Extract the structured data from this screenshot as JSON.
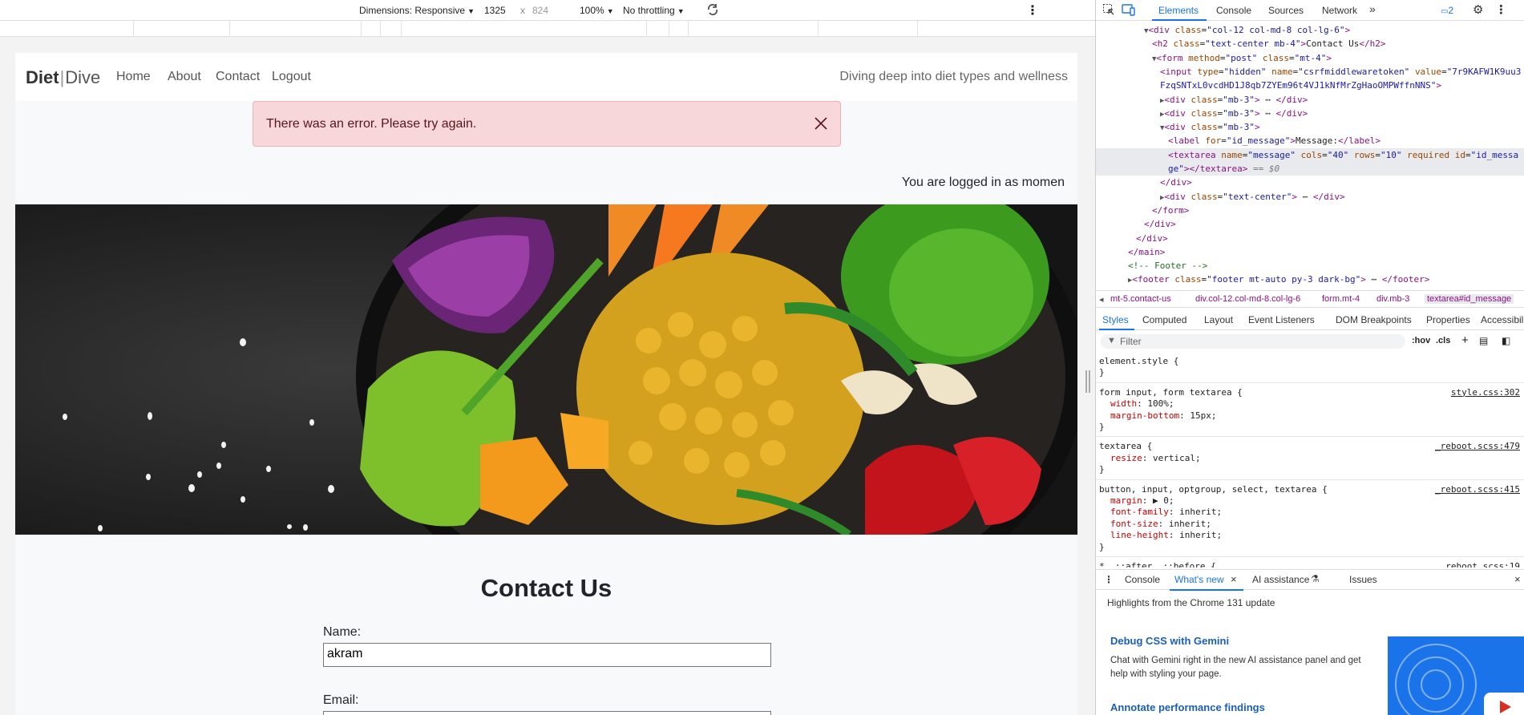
{
  "device_toolbar": {
    "dimensions_label": "Dimensions: Responsive",
    "width": "1325",
    "x_sep": "x",
    "height": "824",
    "zoom": "100%",
    "throttling": "No throttling"
  },
  "site": {
    "brand_bold": "Diet",
    "brand_sep": "|",
    "brand_light": "Dive",
    "nav": [
      "Home",
      "About",
      "Contact",
      "Logout"
    ],
    "tagline": "Diving deep into diet types and wellness",
    "alert": "There was an error. Please try again.",
    "logged_in": "You are logged in as momen",
    "contact_title": "Contact Us",
    "name_label": "Name:",
    "name_value": "akram",
    "email_label": "Email:"
  },
  "devtools": {
    "tabs": [
      "Elements",
      "Console",
      "Sources",
      "Network"
    ],
    "issues_count": "2",
    "dom": [
      {
        "indent": 0,
        "html": "<span class='tri'>▼</span><span class='tag'>&lt;div</span> <span class='attr'>class</span>=<span class='val'>\"col-12 col-md-8 col-lg-6\"</span><span class='tag'>&gt;</span>"
      },
      {
        "indent": 1,
        "html": "<span class='tag'>&lt;h2</span> <span class='attr'>class</span>=<span class='val'>\"text-center mb-4\"</span><span class='tag'>&gt;</span><span class='txt'>Contact Us</span><span class='tag'>&lt;/h2&gt;</span>"
      },
      {
        "indent": 1,
        "html": "<span class='tri'>▼</span><span class='tag'>&lt;form</span> <span class='attr'>method</span>=<span class='val'>\"post\"</span> <span class='attr'>class</span>=<span class='val'>\"mt-4\"</span><span class='tag'>&gt;</span>"
      },
      {
        "indent": 2,
        "html": "<span class='tag'>&lt;input</span> <span class='attr'>type</span>=<span class='val'>\"hidden\"</span> <span class='attr'>name</span>=<span class='val'>\"csrfmiddlewaretoken\"</span> <span class='attr'>value</span>=<span class='val'>\"7r9KAFW1K9uu3</span>"
      },
      {
        "indent": 2,
        "html": "<span class='val'>FzqSNTxL0vcdHD1J8qb7ZYEm96t4VJ1kNfMrZgHaoOMPWffnNNS\"</span><span class='tag'>&gt;</span>"
      },
      {
        "indent": 2,
        "html": "<span class='tri'>▶</span><span class='tag'>&lt;div</span> <span class='attr'>class</span>=<span class='val'>\"mb-3\"</span><span class='tag'>&gt;</span> ⋯ <span class='tag'>&lt;/div&gt;</span>"
      },
      {
        "indent": 2,
        "html": "<span class='tri'>▶</span><span class='tag'>&lt;div</span> <span class='attr'>class</span>=<span class='val'>\"mb-3\"</span><span class='tag'>&gt;</span> ⋯ <span class='tag'>&lt;/div&gt;</span>"
      },
      {
        "indent": 2,
        "html": "<span class='tri'>▼</span><span class='tag'>&lt;div</span> <span class='attr'>class</span>=<span class='val'>\"mb-3\"</span><span class='tag'>&gt;</span>"
      },
      {
        "indent": 3,
        "html": "<span class='tag'>&lt;label</span> <span class='attr'>for</span>=<span class='val'>\"id_message\"</span><span class='tag'>&gt;</span><span class='txt'>Message:</span><span class='tag'>&lt;/label&gt;</span>"
      },
      {
        "indent": 3,
        "sel": true,
        "html": "<span class='tag'>&lt;textarea</span> <span class='attr'>name</span>=<span class='val'>\"message\"</span> <span class='attr'>cols</span>=<span class='val'>\"40\"</span> <span class='attr'>rows</span>=<span class='val'>\"10\"</span> <span class='attr'>required</span> <span class='attr'>id</span>=<span class='val'>\"id_messa</span>"
      },
      {
        "indent": 3,
        "sel": true,
        "html": "<span class='val'>ge\"</span><span class='tag'>&gt;&lt;/textarea&gt;</span> <span class='eq'>== $0</span>"
      },
      {
        "indent": 2,
        "html": "<span class='tag'>&lt;/div&gt;</span>"
      },
      {
        "indent": 2,
        "html": "<span class='tri'>▶</span><span class='tag'>&lt;div</span> <span class='attr'>class</span>=<span class='val'>\"text-center\"</span><span class='tag'>&gt;</span> ⋯ <span class='tag'>&lt;/div&gt;</span>"
      },
      {
        "indent": 1,
        "html": "<span class='tag'>&lt;/form&gt;</span>"
      },
      {
        "indent": 0,
        "html": "<span class='tag'>&lt;/div&gt;</span>"
      },
      {
        "indent": -1,
        "html": "<span class='tag'>&lt;/div&gt;</span>"
      },
      {
        "indent": -2,
        "html": "<span class='tag'>&lt;/main&gt;</span>"
      },
      {
        "indent": -2,
        "html": "<span class='cmt'>&lt;!-- Footer --&gt;</span>"
      },
      {
        "indent": -2,
        "html": "<span class='tri'>▶</span><span class='tag'>&lt;footer</span> <span class='attr'>class</span>=<span class='val'>\"footer mt-auto py-3 dark-bg\"</span><span class='tag'>&gt;</span> ⋯ <span class='tag'>&lt;/footer&gt;</span>"
      }
    ],
    "breadcrumb": [
      "mt-5.contact-us",
      "div.col-12.col-md-8.col-lg-6",
      "form.mt-4",
      "div.mb-3",
      "textarea#id_message"
    ],
    "style_tabs": [
      "Styles",
      "Computed",
      "Layout",
      "Event Listeners",
      "DOM Breakpoints",
      "Properties",
      "Accessibility"
    ],
    "filter_placeholder": "Filter",
    "hov": ":hov",
    "cls": ".cls",
    "rules": [
      {
        "selector": "element.style {",
        "props": [],
        "source": ""
      },
      {
        "selector": "form input, form textarea {",
        "props": [
          [
            "width",
            "100%;"
          ],
          [
            "margin-bottom",
            "15px;"
          ]
        ],
        "source": "style.css:302"
      },
      {
        "selector": "textarea {",
        "props": [
          [
            "resize",
            "vertical;"
          ]
        ],
        "source": "_reboot.scss:479"
      },
      {
        "selector": "button, input, optgroup, select, textarea {",
        "props": [
          [
            "margin",
            "▶ 0;"
          ],
          [
            "font-family",
            "inherit;"
          ],
          [
            "font-size",
            "inherit;"
          ],
          [
            "line-height",
            "inherit;"
          ]
        ],
        "source": "_reboot.scss:415"
      },
      {
        "selector": "*, ::after, ::before {",
        "props": [],
        "source": "_reboot.scss:19"
      }
    ],
    "drawer_tabs": [
      "Console",
      "What's new",
      "AI assistance",
      "Issues"
    ],
    "highlights": "Highlights from the Chrome 131 update",
    "news": [
      {
        "title": "Debug CSS with Gemini",
        "desc": "Chat with Gemini right in the new AI assistance panel and get help with styling your page."
      },
      {
        "title": "Annotate performance findings",
        "desc": ""
      }
    ]
  }
}
